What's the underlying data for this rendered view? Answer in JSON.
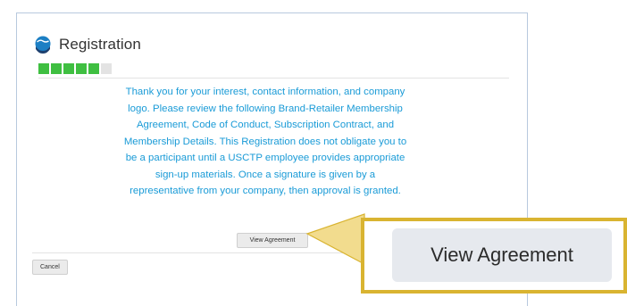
{
  "dialog": {
    "title": "Registration",
    "progress": {
      "filled_steps": 5,
      "total_steps": 6
    },
    "message": "Thank you for your interest, contact information, and company logo. Please review the following Brand-Retailer Membership Agreement, Code of Conduct, Subscription Contract, and Membership Details. This Registration does not obligate you to be a participant until a USCTP employee provides appropriate sign-up materials. Once a signature is given by a representative from your company, then approval is granted.",
    "view_agreement_label": "View Agreement",
    "cancel_label": "Cancel"
  },
  "callout": {
    "label": "View Agreement"
  },
  "colors": {
    "message_text": "#1a9bd7",
    "progress_fill": "#3fbf41",
    "callout_border": "#d9b431",
    "callout_fill": "#f2dc8e"
  },
  "icons": {
    "logo": "globe-hand-logo-icon"
  }
}
